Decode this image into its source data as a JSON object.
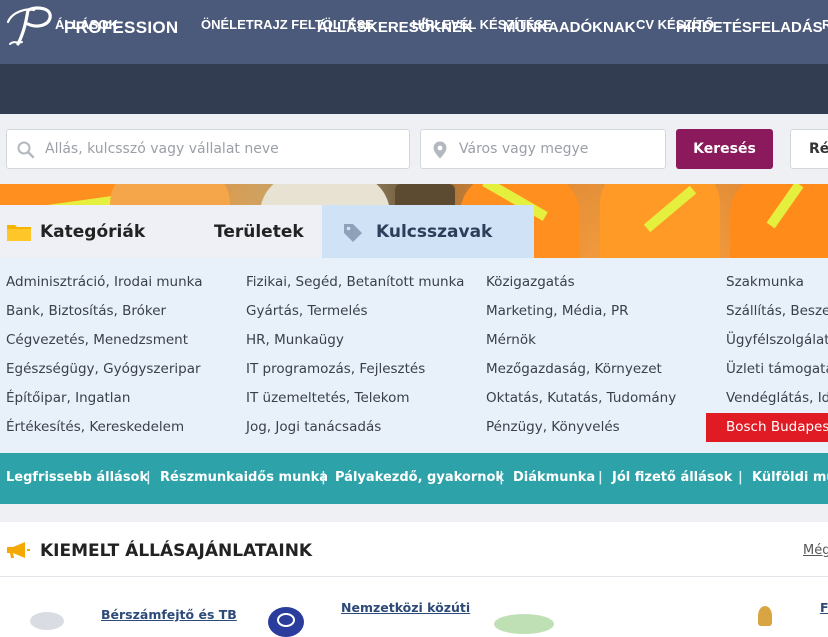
{
  "header": {
    "brand": "PROFESSION",
    "nav": [
      "ÁLLÁSKERESŐKNEK",
      "MUNKAADÓKNAK",
      "HIRDETÉSFELADÁS"
    ]
  },
  "subnav": [
    "ÁLLÁSOK",
    "ÖNÉLETRAJZ FELTÖLTÉSE",
    "HÍRLEVÉL KÉSZÍTÉSE",
    "CV KÉSZÍTŐ",
    "R"
  ],
  "search": {
    "keyword_placeholder": "Állás, kulcsszó vagy vállalat neve",
    "location_placeholder": "Város vagy megye",
    "search_label": "Keresés",
    "extra_label": "Ré"
  },
  "tabs": [
    "Kategóriák",
    "Területek",
    "Kulcsszavak"
  ],
  "categories": {
    "col1": [
      "Adminisztráció, Irodai munka",
      "Bank, Biztosítás, Bróker",
      "Cégvezetés, Menedzsment",
      "Egészségügy, Gyógyszeripar",
      "Építőipar, Ingatlan",
      "Értékesítés, Kereskedelem"
    ],
    "col2": [
      "Fizikai, Segéd, Betanított munka",
      "Gyártás, Termelés",
      "HR, Munkaügy",
      "IT programozás, Fejlesztés",
      "IT üzemeltetés, Telekom",
      "Jog, Jogi tanácsadás"
    ],
    "col3": [
      "Közigazgatás",
      "Marketing, Média, PR",
      "Mérnök",
      "Mezőgazdaság, Környezet",
      "Oktatás, Kutatás, Tudomány",
      "Pénzügy, Könyvelés"
    ],
    "col4": [
      "Szakmunka",
      "Szállítás, Beszer",
      "Ügyfélszolgálat",
      "Üzleti támogatá",
      "Vendéglátás, Ide",
      "Bosch Budapest"
    ]
  },
  "quick_links": [
    "Legfrissebb állások",
    "Részmunkaidős munka",
    "Pályakezdő, gyakornok",
    "Diákmunka",
    "Jól fizető állások",
    "Külföldi mu"
  ],
  "featured": {
    "title": "KIEMELT ÁLLÁSAJÁNLATAINK",
    "more": "Még",
    "jobs": [
      "Bérszámfejtő és TB",
      "Nemzetközi közúti",
      "F"
    ]
  },
  "colors": {
    "header_bg": "#4b5a7a",
    "subnav_bg": "#323d52",
    "accent_button": "#8a1a5c",
    "quick_bar": "#2ea2a9",
    "sponsor_red": "#e01b24",
    "folder_icon": "#f5b400",
    "megaphone_icon": "#f5a800"
  }
}
